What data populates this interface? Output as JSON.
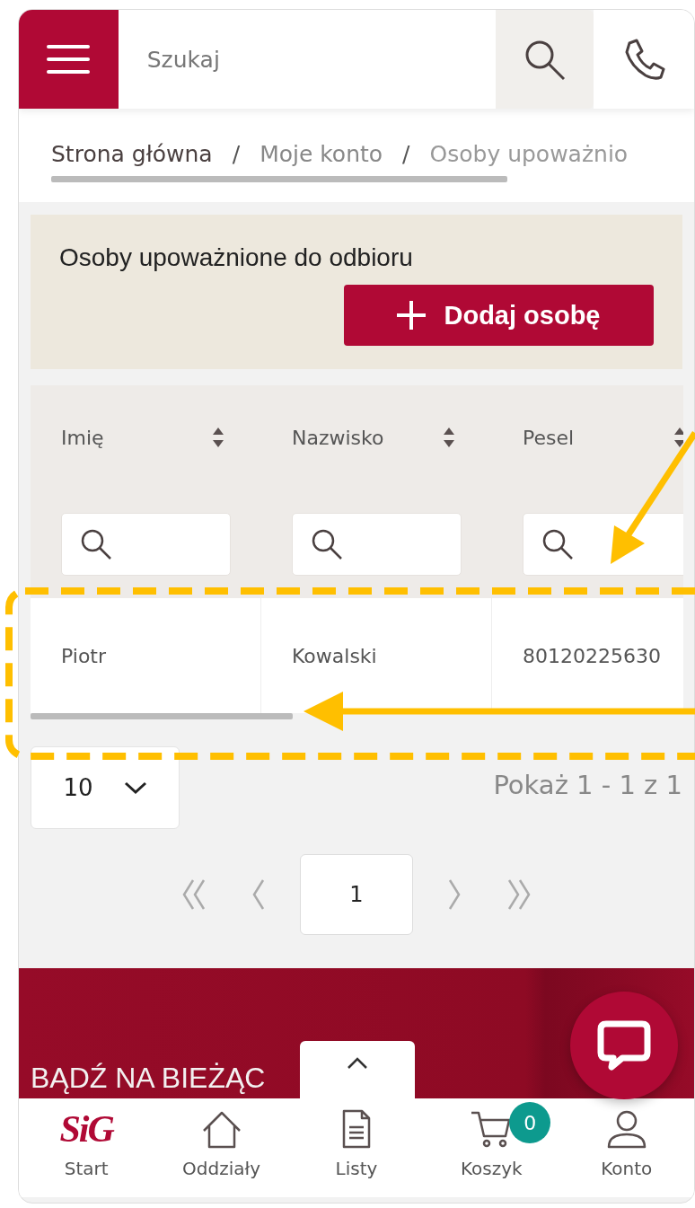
{
  "header": {
    "search_placeholder": "Szukaj"
  },
  "breadcrumb": [
    {
      "kind": "link",
      "label": "Strona główna",
      "current": false
    },
    {
      "kind": "separator",
      "label": "/"
    },
    {
      "kind": "link",
      "label": "Moje konto",
      "current": false
    },
    {
      "kind": "separator",
      "label": "/"
    },
    {
      "kind": "link",
      "label": "Osoby upoważnio",
      "current": true
    }
  ],
  "card": {
    "title": "Osoby upoważnione do odbioru",
    "add_button": "Dodaj osobę"
  },
  "table": {
    "columns": [
      "Imię",
      "Nazwisko",
      "Pesel"
    ],
    "rows": [
      [
        "Piotr",
        "Kowalski",
        "80120225630"
      ]
    ]
  },
  "page_size": "10",
  "range_text": "Pokaż 1 - 1 z 1",
  "pages": [
    {
      "label": "1",
      "selected": true
    }
  ],
  "banner": {
    "text": "BĄDŹ NA BIEŻĄC"
  },
  "bottom_nav": [
    {
      "kind": "logo",
      "logo": "SiG",
      "label": "Start"
    },
    {
      "kind": "home",
      "label": "Oddziały"
    },
    {
      "kind": "list",
      "label": "Listy"
    },
    {
      "kind": "cart",
      "label": "Koszyk",
      "badge": "0"
    },
    {
      "kind": "user",
      "label": "Konto"
    }
  ]
}
